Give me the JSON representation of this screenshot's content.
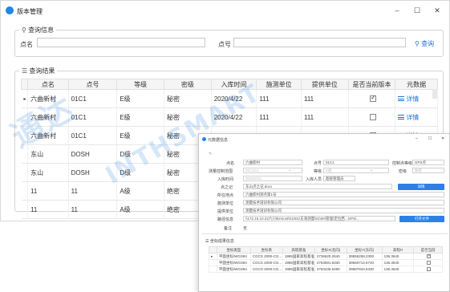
{
  "window": {
    "title": "版本管理"
  },
  "query": {
    "group_title": "查询信息",
    "point_label": "点名",
    "point_value": "",
    "number_label": "点号",
    "number_value": "",
    "search_label": "查询"
  },
  "results": {
    "group_title": "查询结果",
    "columns": [
      "点名",
      "点号",
      "等级",
      "密级",
      "入库时间",
      "施测单位",
      "提供单位",
      "是否当前版本",
      "元数据"
    ],
    "rows": [
      {
        "name": "六曲新村",
        "num": "01C1",
        "grade": "E级",
        "secret": "秘密",
        "date": "2020/4/22",
        "survey": "111",
        "provider": "111",
        "current": true,
        "meta": "详情"
      },
      {
        "name": "六曲新村",
        "num": "01C1",
        "grade": "E级",
        "secret": "秘密",
        "date": "2020/4/22",
        "survey": "111",
        "provider": "111",
        "current": false,
        "meta": "详情"
      },
      {
        "name": "六曲新村",
        "num": "01C1",
        "grade": "E级",
        "secret": "秘密",
        "date": "2020/4/22",
        "survey": "111",
        "provider": "111",
        "current": false,
        "meta": "详情"
      },
      {
        "name": "东山",
        "num": "DOSH",
        "grade": "D级",
        "secret": "秘密",
        "date": "",
        "survey": "",
        "provider": "",
        "current": null,
        "meta": ""
      },
      {
        "name": "东山",
        "num": "DOSH",
        "grade": "D级",
        "secret": "秘密",
        "date": "",
        "survey": "",
        "provider": "",
        "current": null,
        "meta": ""
      },
      {
        "name": "11",
        "num": "11",
        "grade": "A级",
        "secret": "绝密",
        "date": "",
        "survey": "",
        "provider": "",
        "current": null,
        "meta": ""
      },
      {
        "name": "11",
        "num": "11",
        "grade": "A级",
        "secret": "绝密",
        "date": "",
        "survey": "",
        "provider": "",
        "current": null,
        "meta": ""
      }
    ]
  },
  "watermark": {
    "line1": "通达",
    "line2": "INTHSMART"
  },
  "dialog": {
    "title": "元数据信息",
    "fields": {
      "point_name_label": "点名",
      "point_name": "六曲新村",
      "point_num_label": "点号",
      "point_num": "01C1",
      "coord_label": "控制点等级",
      "coord": "GPS点",
      "survey_area_label": "测量控制范围",
      "survey_area": "01C1C1",
      "grade_label": "等级",
      "grade": "E级",
      "secret_label": "密级",
      "secret": "秘密",
      "time_label": "入库时间",
      "time": "2020/4/22",
      "person_label": "入库人员",
      "person": "超级管理员",
      "note_label": "点之记",
      "note": "东山点之记.docx",
      "view_btn": "详情",
      "place_label": "所在地点",
      "place": "六曲新村测点第1号",
      "survey_unit_label": "施测单位",
      "survey_unit": "测量技术培训有限公司",
      "provide_unit_label": "提供单位",
      "provide_unit": "测量技术培训有限公司",
      "path_label": "路径信息",
      "path": "\\\\172.16.10.22六川\\Entrust\\01001\\东海测量\\01\\00\\管理\\定位西...GPS\\...",
      "open_btn": "打开文件",
      "remark_label": "备注",
      "remark": "无"
    },
    "sub_title": "坐标成果信息",
    "sub_columns": [
      "",
      "坐标类型",
      "坐标系",
      "高程基准",
      "坐标X(北向)",
      "坐标Y(东向)",
      "高程H",
      "是否当前"
    ],
    "sub_rows": [
      {
        "idx": "▸",
        "type": "平面坐标/WGS84",
        "sys": "CGCS 2000-CG...",
        "height": "1985国家高程基准",
        "x": "2736620.2540",
        "y": "39556258.2300",
        "h": "136.3640",
        "checked": true
      },
      {
        "idx": "",
        "type": "平面坐标/WGS84",
        "sys": "CGCS 2000-CG...",
        "height": "1985国家高程基准",
        "x": "2763581.8330",
        "y": "39560714.6740",
        "h": "136.3640",
        "checked": false
      },
      {
        "idx": "",
        "type": "平面坐标/WGS84",
        "sys": "CGCS 2000-CG...",
        "height": "1985国家高程基准",
        "x": "2763436.6490",
        "y": "39587934.6430",
        "h": "136.3640",
        "checked": false
      }
    ]
  },
  "colors": {
    "accent": "#1e73d8",
    "button": "#2f7fe8"
  }
}
